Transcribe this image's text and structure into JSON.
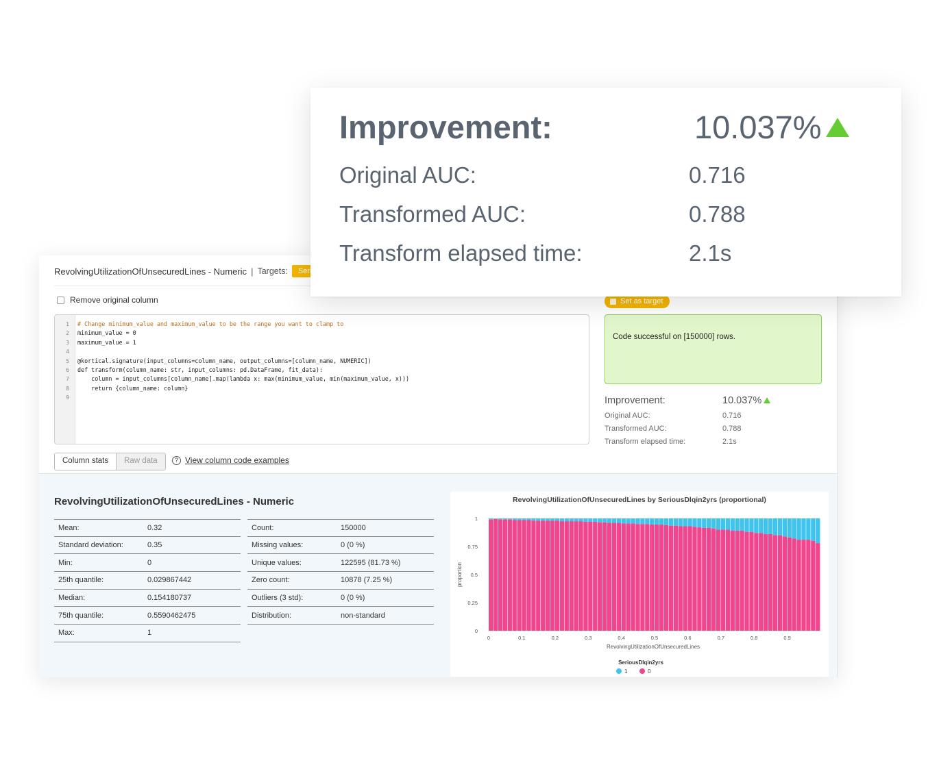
{
  "header": {
    "column_title": "RevolvingUtilizationOfUnsecuredLines - Numeric",
    "separator": "|",
    "targets_label": "Targets:",
    "target_chip": "Serio"
  },
  "options": {
    "remove_original_label": "Remove original column"
  },
  "editor": {
    "line_numbers": [
      "1",
      "2",
      "3",
      "4",
      "5",
      "6",
      "7",
      "8",
      "9"
    ],
    "lines": [
      "# Change minimum_value and maximum_value to be the range you want to clamp to",
      "minimum_value = 0",
      "maximum_value = 1",
      "",
      "@kortical.signature(input_columns=column_name, output_columns=[column_name, NUMERIC])",
      "def transform(column_name: str, input_columns: pd.DataFrame, fit_data):",
      "    column = input_columns[column_name].map(lambda x: max(minimum_value, min(maximum_value, x)))",
      "    return {column_name: column}",
      ""
    ]
  },
  "target_button": "Set as target",
  "result": {
    "message": "Code successful on [150000] rows."
  },
  "metrics": {
    "improvement_label": "Improvement:",
    "improvement_value": "10.037%",
    "original_label": "Original AUC:",
    "original_value": "0.716",
    "transformed_label": "Transformed AUC:",
    "transformed_value": "0.788",
    "elapsed_label": "Transform elapsed time:",
    "elapsed_value": "2.1s",
    "accent_color": "#66cc33"
  },
  "tabs": {
    "column_stats": "Column stats",
    "raw_data": "Raw data"
  },
  "examples_link": "View column code examples",
  "stats": {
    "title": "RevolvingUtilizationOfUnsecuredLines - Numeric",
    "left": [
      {
        "k": "Mean:",
        "v": "0.32"
      },
      {
        "k": "Standard deviation:",
        "v": "0.35"
      },
      {
        "k": "Min:",
        "v": "0"
      },
      {
        "k": "25th quantile:",
        "v": "0.029867442"
      },
      {
        "k": "Median:",
        "v": "0.154180737"
      },
      {
        "k": "75th quantile:",
        "v": "0.5590462475"
      },
      {
        "k": "Max:",
        "v": "1"
      }
    ],
    "right": [
      {
        "k": "Count:",
        "v": "150000"
      },
      {
        "k": "Missing values:",
        "v": "0 (0 %)"
      },
      {
        "k": "Unique values:",
        "v": "122595 (81.73 %)"
      },
      {
        "k": "Zero count:",
        "v": "10878 (7.25 %)"
      },
      {
        "k": "Outliers (3 std):",
        "v": "0 (0 %)"
      },
      {
        "k": "Distribution:",
        "v": "non-standard"
      }
    ]
  },
  "chart_data": {
    "type": "bar",
    "stacked": true,
    "title": "RevolvingUtilizationOfUnsecuredLines by SeriousDlqin2yrs (proportional)",
    "xlabel": "RevolvingUtilizationOfUnsecuredLines",
    "ylabel": "proportion",
    "xlim": [
      0,
      1
    ],
    "ylim": [
      0,
      1
    ],
    "x_ticks": [
      "0",
      "0.1",
      "0.2",
      "0.3",
      "0.4",
      "0.5",
      "0.6",
      "0.7",
      "0.8",
      "0.9"
    ],
    "y_ticks": [
      "0",
      "0.25",
      "0.5",
      "0.75",
      "1"
    ],
    "legend_title": "SeriousDlqin2yrs",
    "legend_position": "bottom",
    "series": [
      {
        "name": "0",
        "color": "#f0468e",
        "values": [
          0.99,
          0.995,
          0.99,
          0.99,
          0.99,
          0.985,
          0.985,
          0.985,
          0.985,
          0.98,
          0.98,
          0.98,
          0.98,
          0.98,
          0.98,
          0.975,
          0.975,
          0.975,
          0.975,
          0.975,
          0.97,
          0.97,
          0.97,
          0.965,
          0.965,
          0.96,
          0.96,
          0.96,
          0.955,
          0.955,
          0.955,
          0.95,
          0.95,
          0.95,
          0.945,
          0.945,
          0.945,
          0.94,
          0.935,
          0.935,
          0.93,
          0.93,
          0.93,
          0.925,
          0.92,
          0.915,
          0.915,
          0.91,
          0.9,
          0.9,
          0.9,
          0.89,
          0.89,
          0.89,
          0.88,
          0.88,
          0.87,
          0.87,
          0.86,
          0.86,
          0.85,
          0.85,
          0.84,
          0.83,
          0.82,
          0.81,
          0.81,
          0.81,
          0.8,
          0.78
        ]
      },
      {
        "name": "1",
        "color": "#40c4ee"
      }
    ]
  }
}
